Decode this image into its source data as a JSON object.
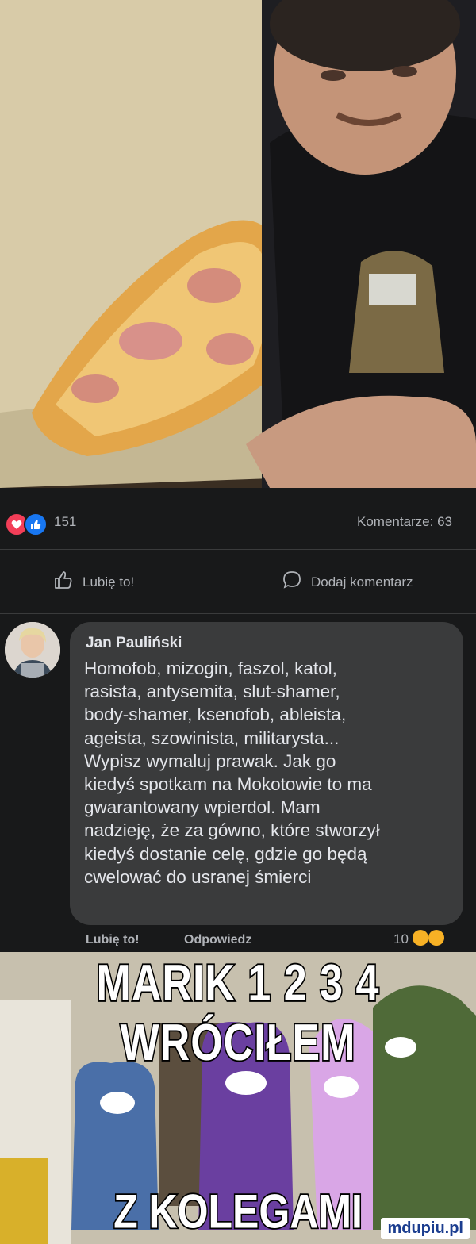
{
  "post": {
    "reaction_count": "151",
    "comments_label": "Komentarze: 63"
  },
  "actions": {
    "like_label": "Lubię to!",
    "comment_label": "Dodaj komentarz"
  },
  "comment": {
    "author": "Jan Pauliński",
    "lines": [
      "Homofob, mizogin, faszol, katol,",
      "rasista, antysemita, slut-shamer,",
      "body-shamer, ksenofob, ableista,",
      "ageista, szowinista, militarysta...",
      "Wypisz wymaluj prawak. Jak go",
      "kiedyś spotkam na Mokotowie to ma",
      "gwarantowany wpierdol. Mam",
      "nadzieję, że za gówno, które stworzył",
      "kiedyś dostanie celę, gdzie go będą",
      "cwelować do usranej śmierci"
    ],
    "like_label": "Lubię to!",
    "reply_label": "Odpowiedz",
    "reaction_count": "10"
  },
  "meme": {
    "top_text": "MARIK 1 2 3 4 WRÓCIŁEM",
    "bottom_text": "Z KOLEGAMI",
    "watermark": "mdupiu.pl"
  },
  "colors": {
    "background": "#18191a",
    "like_blue": "#1877f2",
    "love_red": "#f33e58",
    "bubble": "#3a3b3c"
  }
}
